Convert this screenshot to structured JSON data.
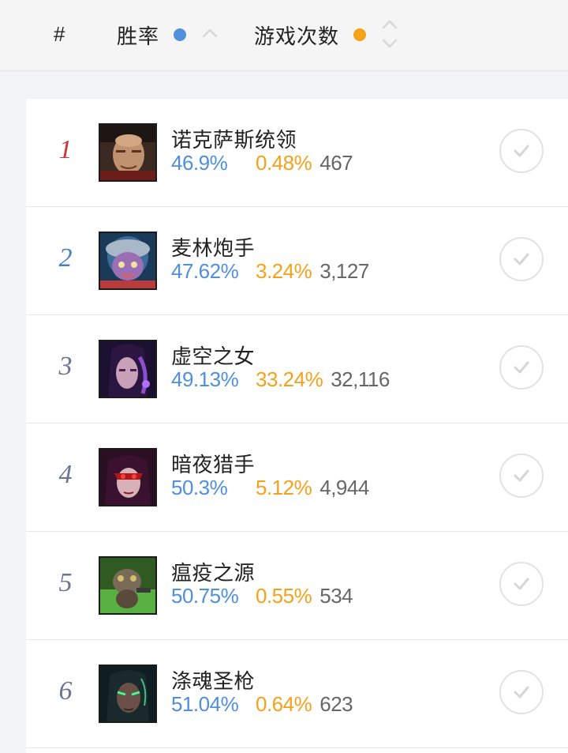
{
  "header": {
    "rank_label": "#",
    "winrate_label": "胜率",
    "pickrate_label": "游戏次数",
    "winrate_color": "#4f8fdc",
    "pickrate_color": "#f5a11a"
  },
  "rows": [
    {
      "rank": "1",
      "name": "诺克萨斯统领",
      "winrate": "46.9%",
      "pickrate": "0.48%",
      "games": "467",
      "rank_color": "#d0343c",
      "avatar_icon": "swain-portrait"
    },
    {
      "rank": "2",
      "name": "麦林炮手",
      "winrate": "47.62%",
      "pickrate": "3.24%",
      "games": "3,127",
      "rank_color": "#4a7ec0",
      "avatar_icon": "tristana-portrait"
    },
    {
      "rank": "3",
      "name": "虚空之女",
      "winrate": "49.13%",
      "pickrate": "33.24%",
      "games": "32,116",
      "rank_color": "#6b7590",
      "avatar_icon": "kaisa-portrait"
    },
    {
      "rank": "4",
      "name": "暗夜猎手",
      "winrate": "50.3%",
      "pickrate": "5.12%",
      "games": "4,944",
      "rank_color": "#6b7590",
      "avatar_icon": "vayne-portrait"
    },
    {
      "rank": "5",
      "name": "瘟疫之源",
      "winrate": "50.75%",
      "pickrate": "0.55%",
      "games": "534",
      "rank_color": "#6b7590",
      "avatar_icon": "twitch-portrait"
    },
    {
      "rank": "6",
      "name": "涤魂圣枪",
      "winrate": "51.04%",
      "pickrate": "0.64%",
      "games": "623",
      "rank_color": "#6b7590",
      "avatar_icon": "senna-portrait"
    }
  ]
}
